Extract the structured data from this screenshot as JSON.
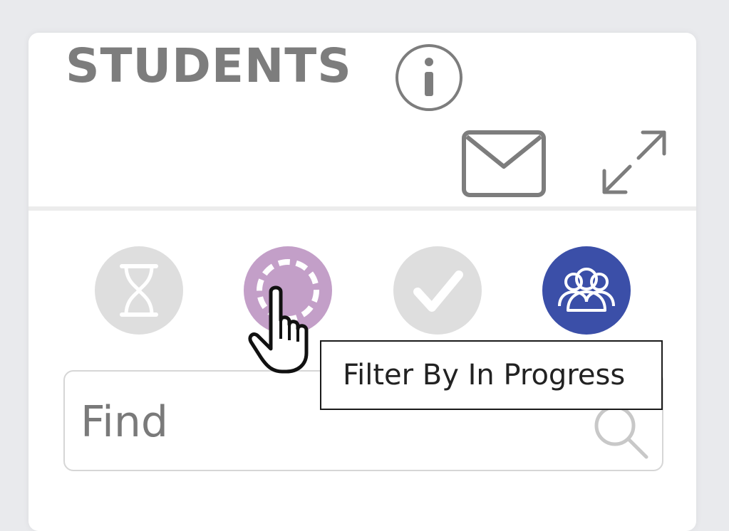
{
  "panel": {
    "title": "STUDENTS"
  },
  "header_icons": {
    "info": "info-icon",
    "mail": "mail-icon",
    "expand": "expand-icon"
  },
  "filters": [
    {
      "name": "pending",
      "icon": "hourglass-icon",
      "color": "#dedede",
      "active": false
    },
    {
      "name": "in-progress",
      "icon": "in-progress-icon",
      "color": "#c39fc8",
      "active": false,
      "hovered": true
    },
    {
      "name": "complete",
      "icon": "checkmark-icon",
      "color": "#dedede",
      "active": false
    },
    {
      "name": "all",
      "icon": "group-icon",
      "color": "#3b4fa8",
      "active": true
    }
  ],
  "tooltip": {
    "text": "Filter By In Progress"
  },
  "search": {
    "placeholder": "Find",
    "value": ""
  },
  "colors": {
    "title": "#7d7d7d",
    "accent": "#3b4fa8",
    "in_progress": "#c39fc8"
  }
}
